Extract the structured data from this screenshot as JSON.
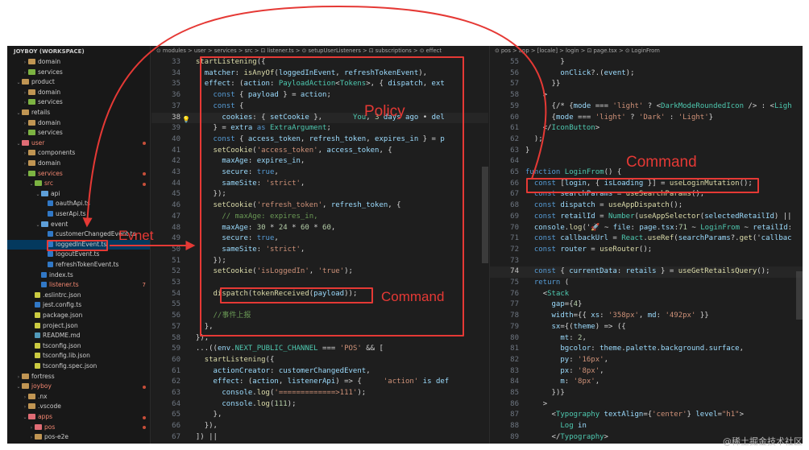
{
  "sidebar": {
    "title": "JOYBOY (WORKSPACE)",
    "items": [
      {
        "label": "domain",
        "depth": 1,
        "kind": "folder",
        "chev": "›"
      },
      {
        "label": "services",
        "depth": 1,
        "kind": "folder",
        "chev": "›"
      },
      {
        "label": "product",
        "depth": 0,
        "kind": "folder",
        "chev": "⌄"
      },
      {
        "label": "domain",
        "depth": 1,
        "kind": "folder",
        "chev": "›"
      },
      {
        "label": "services",
        "depth": 1,
        "kind": "folder",
        "chev": "›"
      },
      {
        "label": "retails",
        "depth": 0,
        "kind": "folder",
        "chev": "⌄"
      },
      {
        "label": "domain",
        "depth": 1,
        "kind": "folder",
        "chev": "›"
      },
      {
        "label": "services",
        "depth": 1,
        "kind": "folder",
        "chev": "›"
      },
      {
        "label": "user",
        "depth": 0,
        "kind": "folder",
        "chev": "⌄",
        "state": "err",
        "dot": true
      },
      {
        "label": "components",
        "depth": 1,
        "kind": "folder",
        "chev": "›"
      },
      {
        "label": "domain",
        "depth": 1,
        "kind": "folder",
        "chev": "›"
      },
      {
        "label": "services",
        "depth": 1,
        "kind": "folder",
        "chev": "⌄",
        "state": "err",
        "dot": true
      },
      {
        "label": "src",
        "depth": 2,
        "kind": "folder",
        "chev": "⌄",
        "state": "err",
        "dot": true
      },
      {
        "label": "api",
        "depth": 3,
        "kind": "folder",
        "chev": "⌄"
      },
      {
        "label": "oauthApi.ts",
        "depth": 4,
        "kind": "ts"
      },
      {
        "label": "userApi.ts",
        "depth": 4,
        "kind": "ts"
      },
      {
        "label": "event",
        "depth": 3,
        "kind": "folder",
        "chev": "⌄"
      },
      {
        "label": "customerChangedEvent.ts",
        "depth": 4,
        "kind": "ts"
      },
      {
        "label": "loggedInEvent.ts",
        "depth": 4,
        "kind": "ts",
        "selected": true
      },
      {
        "label": "logoutEvent.ts",
        "depth": 4,
        "kind": "ts"
      },
      {
        "label": "refreshTokenEvent.ts",
        "depth": 4,
        "kind": "ts"
      },
      {
        "label": "index.ts",
        "depth": 3,
        "kind": "ts"
      },
      {
        "label": "listener.ts",
        "depth": 3,
        "kind": "ts",
        "state": "err",
        "badge": "7"
      },
      {
        "label": ".eslintrc.json",
        "depth": 2,
        "kind": "json"
      },
      {
        "label": "jest.config.ts",
        "depth": 2,
        "kind": "ts"
      },
      {
        "label": "package.json",
        "depth": 2,
        "kind": "json"
      },
      {
        "label": "project.json",
        "depth": 2,
        "kind": "json"
      },
      {
        "label": "README.md",
        "depth": 2,
        "kind": "md"
      },
      {
        "label": "tsconfig.json",
        "depth": 2,
        "kind": "json"
      },
      {
        "label": "tsconfig.lib.json",
        "depth": 2,
        "kind": "json"
      },
      {
        "label": "tsconfig.spec.json",
        "depth": 2,
        "kind": "json"
      },
      {
        "label": "fortress",
        "depth": 0,
        "kind": "folder",
        "chev": "›"
      },
      {
        "label": "joyboy",
        "depth": 0,
        "kind": "folder",
        "chev": "⌄",
        "state": "err",
        "dot": true
      },
      {
        "label": ".nx",
        "depth": 1,
        "kind": "folder",
        "chev": "›"
      },
      {
        "label": ".vscode",
        "depth": 1,
        "kind": "folder",
        "chev": "›"
      },
      {
        "label": "apps",
        "depth": 1,
        "kind": "folder",
        "chev": "⌄",
        "state": "err",
        "dot": true
      },
      {
        "label": "pos",
        "depth": 2,
        "kind": "folder",
        "chev": "›",
        "state": "err",
        "dot": true
      },
      {
        "label": "pos-e2e",
        "depth": 2,
        "kind": "folder",
        "chev": "›"
      }
    ]
  },
  "left_editor": {
    "breadcrumb": "⊙ modules > user > services > src > ⊡ listener.ts > ⊙ setupUserListeners > ⊡ subscriptions > ⊙ effect",
    "lines": [
      {
        "n": "33",
        "t": "  startListening({"
      },
      {
        "n": "34",
        "t": "    matcher: isAnyOf(loggedInEvent, refreshTokenEvent),"
      },
      {
        "n": "35",
        "t": "    effect: (action: PayloadAction<Tokens>, { dispatch, ext"
      },
      {
        "n": "36",
        "t": "      const { payload } = action;"
      },
      {
        "n": "37",
        "t": "      const {"
      },
      {
        "n": "38",
        "t": "        cookies: { setCookie },       You, 3 days ago • del",
        "cur": true
      },
      {
        "n": "39",
        "t": "      } = extra as ExtraArgument;"
      },
      {
        "n": "40",
        "t": "      const { access_token, refresh_token, expires_in } = p"
      },
      {
        "n": "41",
        "t": "      setCookie('access_token', access_token, {"
      },
      {
        "n": "42",
        "t": "        maxAge: expires_in,"
      },
      {
        "n": "43",
        "t": "        secure: true,"
      },
      {
        "n": "44",
        "t": "        sameSite: 'strict',"
      },
      {
        "n": "45",
        "t": "      });"
      },
      {
        "n": "46",
        "t": "      setCookie('refresh_token', refresh_token, {"
      },
      {
        "n": "47",
        "t": "        // maxAge: expires_in,"
      },
      {
        "n": "48",
        "t": "        maxAge: 30 * 24 * 60 * 60,"
      },
      {
        "n": "49",
        "t": "        secure: true,"
      },
      {
        "n": "50",
        "t": "        sameSite: 'strict',"
      },
      {
        "n": "51",
        "t": "      });"
      },
      {
        "n": "52",
        "t": "      setCookie('isLoggedIn', 'true');"
      },
      {
        "n": "53",
        "t": ""
      },
      {
        "n": "54",
        "t": "      dispatch(tokenReceived(payload));"
      },
      {
        "n": "55",
        "t": ""
      },
      {
        "n": "56",
        "t": "      //事件上报"
      },
      {
        "n": "57",
        "t": "    },"
      },
      {
        "n": "58",
        "t": "  }),"
      },
      {
        "n": "59",
        "t": "  ...((env.NEXT_PUBLIC_CHANNEL === 'POS' && ["
      },
      {
        "n": "60",
        "t": "    startListening({"
      },
      {
        "n": "61",
        "t": "      actionCreator: customerChangedEvent,"
      },
      {
        "n": "62",
        "t": "      effect: (action, listenerApi) => {     'action' is def"
      },
      {
        "n": "63",
        "t": "        console.log('=============>111');"
      },
      {
        "n": "64",
        "t": "        console.log(111);"
      },
      {
        "n": "65",
        "t": "      },"
      },
      {
        "n": "66",
        "t": "    }),"
      },
      {
        "n": "67",
        "t": "  ]) ||"
      }
    ]
  },
  "right_editor": {
    "breadcrumb": "⊙ pos > app > [locale] > login > ⊡ page.tsx > ⊙ LoginFrom",
    "lines": [
      {
        "n": "55",
        "t": "        }"
      },
      {
        "n": "56",
        "t": "        onClick?.(event);"
      },
      {
        "n": "57",
        "t": "      }}"
      },
      {
        "n": "58",
        "t": "    >"
      },
      {
        "n": "59",
        "t": "      {/* {mode === 'light' ? <DarkModeRoundedIcon /> : <Ligh"
      },
      {
        "n": "60",
        "t": "      {mode === 'light' ? 'Dark' : 'Light'}"
      },
      {
        "n": "61",
        "t": "    </IconButton>"
      },
      {
        "n": "62",
        "t": "  );"
      },
      {
        "n": "63",
        "t": "}"
      },
      {
        "n": "64",
        "t": ""
      },
      {
        "n": "65",
        "t": "function LoginFrom() {"
      },
      {
        "n": "66",
        "t": "  const [login, { isLoading }] = useLoginMutation();"
      },
      {
        "n": "67",
        "t": "  const searchParams = useSearchParams();"
      },
      {
        "n": "68",
        "t": "  const dispatch = useAppDispatch();"
      },
      {
        "n": "69",
        "t": "  const retailId = Number(useAppSelector(selectedRetailId) ||"
      },
      {
        "n": "70",
        "t": "  console.log('🚀 ~ file: page.tsx:71 ~ LoginFrom ~ retailId:"
      },
      {
        "n": "71",
        "t": "  const callbackUrl = React.useRef(searchParams?.get('callbac"
      },
      {
        "n": "72",
        "t": "  const router = useRouter();"
      },
      {
        "n": "73",
        "t": ""
      },
      {
        "n": "74",
        "t": "  const { currentData: retails } = useGetRetailsQuery();",
        "cur": true
      },
      {
        "n": "75",
        "t": "  return ("
      },
      {
        "n": "76",
        "t": "    <Stack"
      },
      {
        "n": "77",
        "t": "      gap={4}"
      },
      {
        "n": "78",
        "t": "      width={{ xs: '358px', md: '492px' }}"
      },
      {
        "n": "79",
        "t": "      sx={(theme) => ({"
      },
      {
        "n": "80",
        "t": "        mt: 2,"
      },
      {
        "n": "81",
        "t": "        bgcolor: theme.palette.background.surface,"
      },
      {
        "n": "82",
        "t": "        py: '16px',"
      },
      {
        "n": "83",
        "t": "        px: '8px',"
      },
      {
        "n": "84",
        "t": "        m: '8px',"
      },
      {
        "n": "85",
        "t": "      })}"
      },
      {
        "n": "86",
        "t": "    >"
      },
      {
        "n": "87",
        "t": "      <Typography textAlign={'center'} level=\"h1\">"
      },
      {
        "n": "88",
        "t": "        Log in"
      },
      {
        "n": "89",
        "t": "      </Typography>"
      }
    ]
  },
  "annotations": {
    "policy": "Policy",
    "command_left": "Command",
    "command_right": "Command",
    "event": "Evnet"
  },
  "watermark": "@稀土掘金技术社区",
  "colors": {
    "annotation": "#e53935",
    "editor_bg": "#1e1e1e",
    "sidebar_bg": "#181818",
    "selection": "#04395e"
  }
}
